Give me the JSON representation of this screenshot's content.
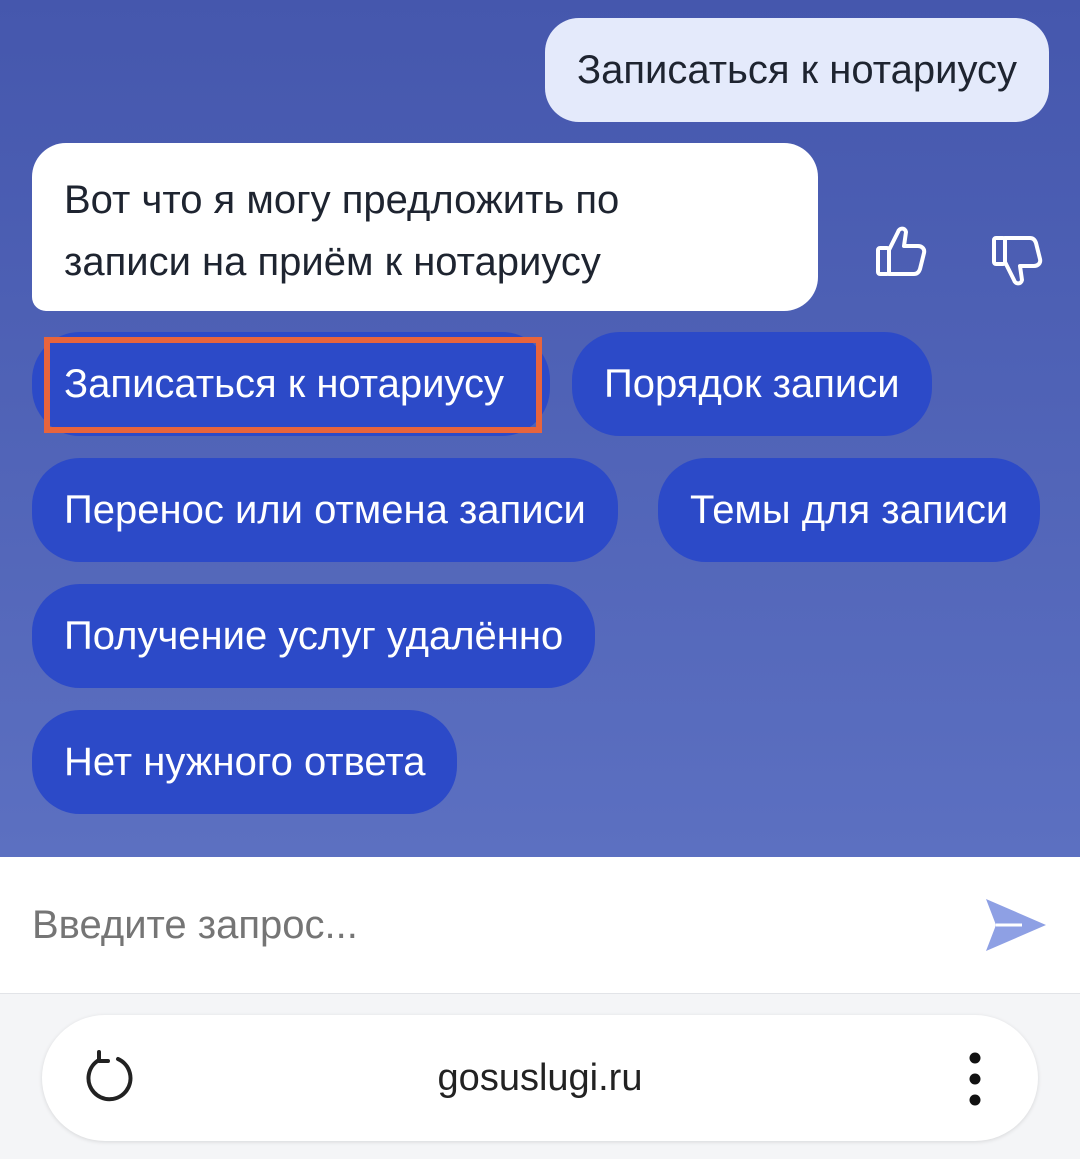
{
  "chat": {
    "user_message": "Записаться к нотариусу",
    "bot_message_line1": "Вот что я могу предложить по",
    "bot_message_line2": "записи на приём к нотариусу",
    "like_icon": "thumbs-up-icon",
    "dislike_icon": "thumbs-down-icon"
  },
  "chips": [
    {
      "label": "Записаться к нотариусу"
    },
    {
      "label": "Порядок записи"
    },
    {
      "label": "Перенос или отмена записи"
    },
    {
      "label": "Темы для записи"
    },
    {
      "label": "Получение услуг удалённо"
    },
    {
      "label": "Нет нужного ответа"
    }
  ],
  "input": {
    "placeholder": "Введите запрос...",
    "send_icon": "send-icon"
  },
  "browser": {
    "url": "gosuslugi.ru",
    "reload_icon": "reload-icon",
    "menu_icon": "more-vertical-icon"
  },
  "colors": {
    "chat_background": "#4f62b6",
    "chip_background": "#2c4ac8",
    "user_bubble": "#e4eafb",
    "highlight": "#e8643c",
    "send_icon": "#8ea0e4"
  }
}
